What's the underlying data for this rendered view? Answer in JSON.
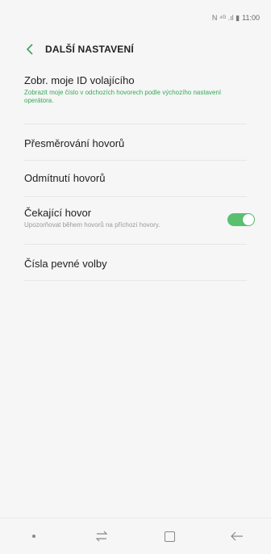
{
  "status_bar": {
    "icons": "N ⁴ᴳ .ıl ▮",
    "time": "11:00"
  },
  "header": {
    "back_icon": "chevron-left-icon",
    "title": "DALŠÍ NASTAVENÍ"
  },
  "items": [
    {
      "title": "Zobr. moje ID volajícího",
      "subtitle": "Zobrazit moje číslo v odchozích hovorech podle výchozího nastavení operátora."
    },
    {
      "title": "Přesměrování hovorů"
    },
    {
      "title": "Odmítnutí hovorů"
    },
    {
      "title": "Čekající hovor",
      "subtitle": "Upozorňovat během hovorů na příchozí hovory.",
      "toggle_on": true
    },
    {
      "title": "Čísla pevné volby"
    }
  ],
  "nav": {
    "recent_icon": "recent-apps-icon",
    "home_icon": "home-icon",
    "back_icon": "back-arrow-icon"
  },
  "colors": {
    "accent": "#39a85a",
    "toggle": "#58c06f"
  }
}
